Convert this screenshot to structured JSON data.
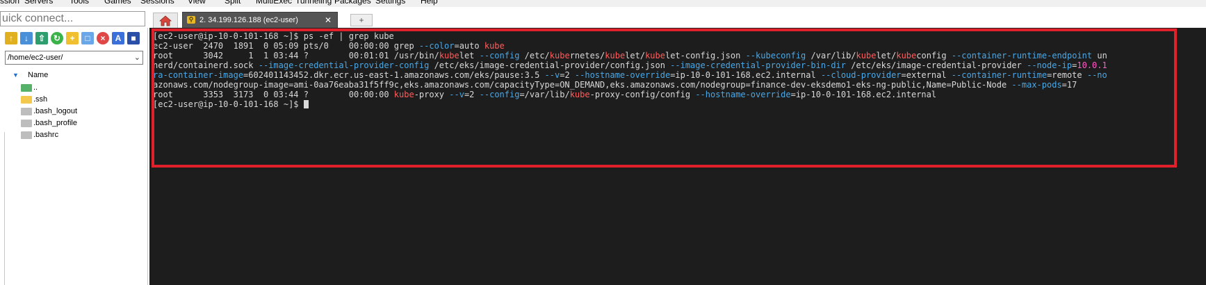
{
  "menu": {
    "items": [
      "ssion",
      "Servers",
      "Tools",
      "Games",
      "Sessions",
      "View",
      "Split",
      "MultiExec",
      "Tunneling",
      "Packages",
      "Settings",
      "Help"
    ]
  },
  "quick_connect": {
    "placeholder": "uick connect..."
  },
  "left_panel": {
    "path": "/home/ec2-user/",
    "column_header": "Name",
    "files": [
      {
        "name": "..",
        "type": "up"
      },
      {
        "name": ".ssh",
        "type": "folder"
      },
      {
        "name": ".bash_logout",
        "type": "file"
      },
      {
        "name": ".bash_profile",
        "type": "file"
      },
      {
        "name": ".bashrc",
        "type": "file"
      }
    ]
  },
  "tabs": {
    "session_label": "2. 34.199.126.188 (ec2-user)",
    "close_glyph": "✕",
    "new_tab_glyph": "+"
  },
  "terminal": {
    "lines": [
      [
        [
          "t",
          "[ec2-user@ip-10-0-101-168 ~]$ ps -ef | grep kube"
        ]
      ],
      [
        [
          "t",
          "ec2-user  2470  1891  0 05:09 pts/0    00:00:00 grep "
        ],
        [
          "o",
          "--color"
        ],
        [
          "t",
          "=auto "
        ],
        [
          "k",
          "kube"
        ]
      ],
      [
        [
          "t",
          "root      3042     1  1 03:44 ?        00:01:01 /usr/bin/"
        ],
        [
          "k",
          "kube"
        ],
        [
          "t",
          "let "
        ],
        [
          "o",
          "--config"
        ],
        [
          "t",
          " /etc/"
        ],
        [
          "k",
          "kube"
        ],
        [
          "t",
          "rnetes/"
        ],
        [
          "k",
          "kube"
        ],
        [
          "t",
          "let/"
        ],
        [
          "k",
          "kube"
        ],
        [
          "t",
          "let-config.json "
        ],
        [
          "o",
          "--kube"
        ],
        [
          "o",
          "config"
        ],
        [
          "t",
          " /var/lib/"
        ],
        [
          "k",
          "kube"
        ],
        [
          "t",
          "let/"
        ],
        [
          "k",
          "kube"
        ],
        [
          "t",
          "config "
        ],
        [
          "o",
          "--container-runtime-endpoint"
        ],
        [
          "t",
          " un"
        ]
      ],
      [
        [
          "t",
          "nerd/containerd.sock "
        ],
        [
          "o",
          "--image-credential-provider-config"
        ],
        [
          "t",
          " /etc/eks/image-credential-provider/config.json "
        ],
        [
          "o",
          "--image-credential-provider-bin-dir"
        ],
        [
          "t",
          " /etc/eks/image-credential-provider "
        ],
        [
          "o",
          "--node-ip"
        ],
        [
          "t",
          "="
        ],
        [
          "i",
          "10.0.1"
        ]
      ],
      [
        [
          "o",
          "ra-container-image"
        ],
        [
          "t",
          "=602401143452.dkr.ecr.us-east-1.amazonaws.com/eks/pause:3.5 "
        ],
        [
          "o",
          "--v"
        ],
        [
          "t",
          "=2 "
        ],
        [
          "o",
          "--hostname-override"
        ],
        [
          "t",
          "=ip-10-0-101-168.ec2.internal "
        ],
        [
          "o",
          "--cloud-provider"
        ],
        [
          "t",
          "=external "
        ],
        [
          "o",
          "--container-runtime"
        ],
        [
          "t",
          "=remote "
        ],
        [
          "o",
          "--no"
        ]
      ],
      [
        [
          "t",
          "azonaws.com/nodegroup-image=ami-0aa76eaba31f5ff9c,eks.amazonaws.com/capacityType=ON_DEMAND,eks.amazonaws.com/nodegroup=finance-dev-eksdemo1-eks-ng-public,Name=Public-Node "
        ],
        [
          "o",
          "--max-pods"
        ],
        [
          "t",
          "=17"
        ]
      ],
      [
        [
          "t",
          "root      3353  3173  0 03:44 ?        00:00:00 "
        ],
        [
          "k",
          "kube"
        ],
        [
          "t",
          "-proxy "
        ],
        [
          "o",
          "--v"
        ],
        [
          "t",
          "=2 "
        ],
        [
          "o",
          "--config"
        ],
        [
          "t",
          "=/var/lib/"
        ],
        [
          "k",
          "kube"
        ],
        [
          "t",
          "-proxy-config/config "
        ],
        [
          "o",
          "--hostname-override"
        ],
        [
          "t",
          "=ip-10-0-101-168.ec2.internal"
        ]
      ],
      [
        [
          "t",
          "[ec2-user@ip-10-0-101-168 ~]$ "
        ],
        [
          "c",
          ""
        ]
      ]
    ]
  },
  "colors": {
    "highlight_border": "#e0202a",
    "terminal_bg": "#1d1d1d",
    "kube_match": "#ff5d5d",
    "option": "#4aa8e6",
    "ip": "#ff5cc8"
  },
  "icons": [
    "home-icon",
    "key-icon",
    "close-icon",
    "new-tab-icon",
    "upload-icon",
    "download-icon",
    "refresh-icon",
    "new-folder-icon",
    "new-file-icon",
    "delete-icon",
    "rename-icon",
    "settings-icon",
    "chevron-down-icon",
    "tree-toggle-icon",
    "folder-icon",
    "file-icon"
  ]
}
